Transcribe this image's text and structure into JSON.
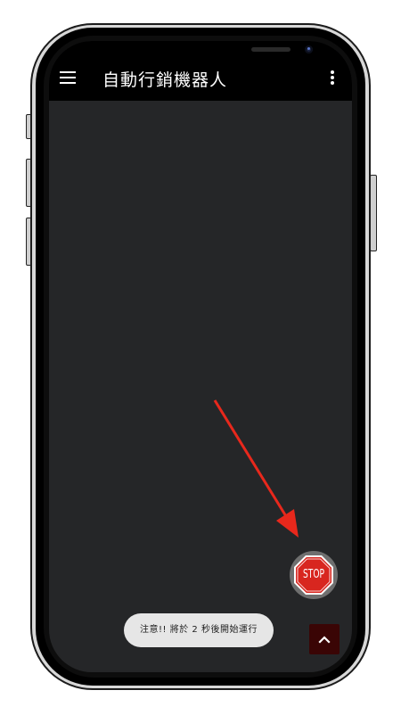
{
  "app": {
    "title": "自動行銷機器人"
  },
  "icons": {
    "menu": "hamburger-menu-icon",
    "overflow": "more-vert-icon",
    "stop": "stop-sign-icon",
    "scroll_top": "chevron-up-icon",
    "annotation": "red-arrow-icon"
  },
  "stop_button": {
    "label": "STOP"
  },
  "toast": {
    "message": "注意!! 將於 2 秒後開始運行"
  },
  "colors": {
    "appbar": "#000000",
    "screen_background": "#252628",
    "stop_red": "#d8261f",
    "annotation_red": "#e8281c",
    "scroll_top_background": "#3a0505"
  }
}
